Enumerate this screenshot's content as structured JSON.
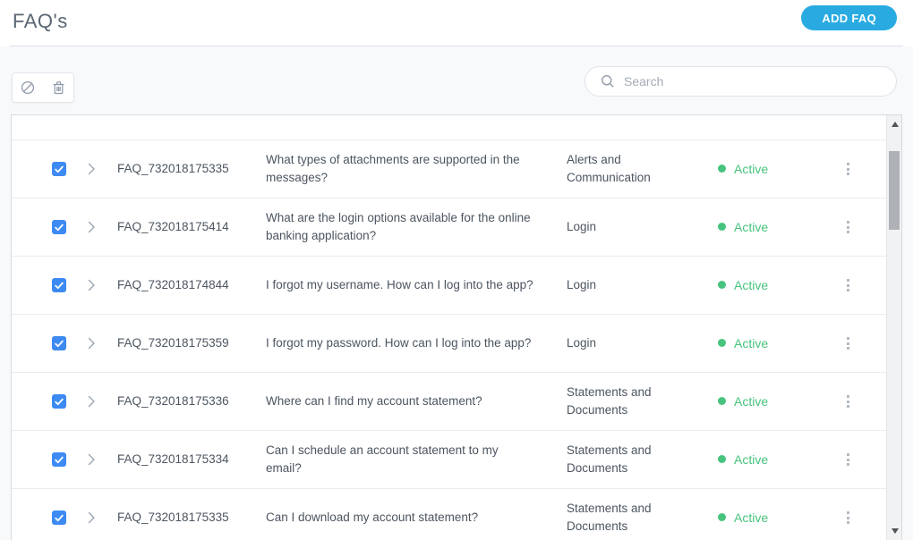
{
  "page": {
    "title": "FAQ's"
  },
  "header": {
    "add_faq_button": "ADD FAQ"
  },
  "toolbar": {
    "bulk_actions": [
      {
        "name": "disable",
        "icon": "ban-icon"
      },
      {
        "name": "delete",
        "icon": "trash-icon"
      }
    ],
    "search": {
      "placeholder": "Search",
      "value": "",
      "icon": "search-icon"
    }
  },
  "table": {
    "rows": [
      {
        "checked": true,
        "id": "FAQ_732018175335",
        "question": "What types of attachments are supported in the messages?",
        "category": "Alerts and Communication",
        "status": "Active"
      },
      {
        "checked": true,
        "id": "FAQ_732018175414",
        "question": "What are the login options available for the online banking application?",
        "category": "Login",
        "status": "Active"
      },
      {
        "checked": true,
        "id": "FAQ_732018174844",
        "question": "I forgot my username. How can I log into the app?",
        "category": "Login",
        "status": "Active"
      },
      {
        "checked": true,
        "id": "FAQ_732018175359",
        "question": "I forgot my password. How can I log into the app?",
        "category": "Login",
        "status": "Active"
      },
      {
        "checked": true,
        "id": "FAQ_732018175336",
        "question": "Where can I find my account statement?",
        "category": "Statements and Documents",
        "status": "Active"
      },
      {
        "checked": true,
        "id": "FAQ_732018175334",
        "question": "Can I schedule an account statement to my email?",
        "category": "Statements and Documents",
        "status": "Active"
      },
      {
        "checked": true,
        "id": "FAQ_732018175335",
        "question": "Can I download my account statement?",
        "category": "Statements and Documents",
        "status": "Active"
      }
    ]
  },
  "colors": {
    "add_button_blue": "#29abe2",
    "checkbox_blue": "#3d8af2",
    "status_active_green": "#47c37e"
  }
}
